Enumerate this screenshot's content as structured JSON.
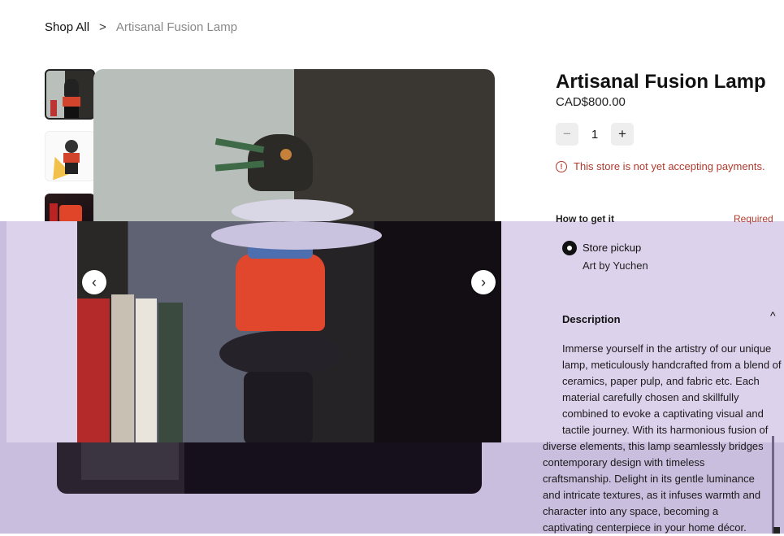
{
  "breadcrumb": {
    "parent": "Shop All",
    "separator": ">",
    "current": "Artisanal Fusion Lamp"
  },
  "gallery": {
    "thumbnails": [
      "lamp-photo-1",
      "lamp-photo-2",
      "lamp-photo-3"
    ],
    "prev_icon": "chevron-left-icon",
    "next_icon": "chevron-right-icon"
  },
  "product": {
    "title": "Artisanal Fusion Lamp",
    "price": "CAD$800.00",
    "quantity": "1",
    "minus": "−",
    "plus": "+",
    "notice": "This store is not yet accepting payments.",
    "notice_icon": "!"
  },
  "fulfillment": {
    "heading": "How to get it",
    "required": "Required",
    "option": "Store pickup",
    "location": "Art by Yuchen"
  },
  "description": {
    "heading": "Description",
    "chevron": "^",
    "text_upper": "Immerse yourself in the artistry of our unique lamp, meticulously handcrafted from a blend of ceramics, paper pulp, and fabric etc. Each material carefully chosen and skillfully combined to evoke a captivating visual and tactile journey. With its harmonious fusion of",
    "text_lower": "diverse elements, this lamp seamlessly bridges contemporary design with timeless craftsmanship. Delight in its gentle luminance and intricate textures, as it infuses warmth and character into any space, becoming a captivating centerpiece in your home décor."
  },
  "colors": {
    "accent_error": "#b03a2e",
    "overlay": "#ddd2ec"
  }
}
